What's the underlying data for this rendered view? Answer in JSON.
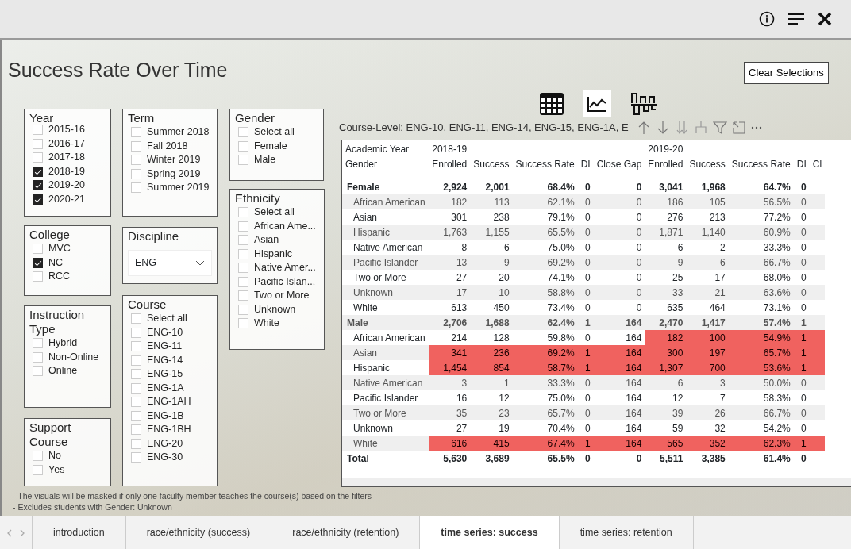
{
  "report_title": "Success Rate Over Time",
  "clear_button": "Clear Selections",
  "slicers": [
    {
      "title": "Year",
      "kind": "list",
      "items": [
        {
          "label": "2015-16",
          "checked": false
        },
        {
          "label": "2016-17",
          "checked": false
        },
        {
          "label": "2017-18",
          "checked": false
        },
        {
          "label": "2018-19",
          "checked": true
        },
        {
          "label": "2019-20",
          "checked": true
        },
        {
          "label": "2020-21",
          "checked": true
        }
      ]
    },
    {
      "title": "Term",
      "kind": "list",
      "items": [
        {
          "label": "Summer 2018",
          "checked": false
        },
        {
          "label": "Fall 2018",
          "checked": false
        },
        {
          "label": "Winter 2019",
          "checked": false
        },
        {
          "label": "Spring 2019",
          "checked": false
        },
        {
          "label": "Summer 2019",
          "checked": false
        }
      ]
    },
    {
      "title": "Gender",
      "kind": "list",
      "items": [
        {
          "label": "Select all",
          "checked": false
        },
        {
          "label": "Female",
          "checked": false
        },
        {
          "label": "Male",
          "checked": false
        }
      ]
    },
    {
      "title": "College",
      "kind": "list",
      "items": [
        {
          "label": "MVC",
          "checked": false
        },
        {
          "label": "NC",
          "checked": true
        },
        {
          "label": "RCC",
          "checked": false
        }
      ]
    },
    {
      "title": "Discipline",
      "kind": "dropdown",
      "value": "ENG"
    },
    {
      "title": "Ethnicity",
      "kind": "list",
      "items": [
        {
          "label": "Select all",
          "checked": false
        },
        {
          "label": "African Ame...",
          "checked": false
        },
        {
          "label": "Asian",
          "checked": false
        },
        {
          "label": "Hispanic",
          "checked": false
        },
        {
          "label": "Native Amer...",
          "checked": false
        },
        {
          "label": "Pacific Islan...",
          "checked": false
        },
        {
          "label": "Two or More",
          "checked": false
        },
        {
          "label": "Unknown",
          "checked": false
        },
        {
          "label": "White",
          "checked": false
        }
      ]
    },
    {
      "title": "Instruction Type",
      "kind": "list",
      "items": [
        {
          "label": "Hybrid",
          "checked": false
        },
        {
          "label": "Non-Online",
          "checked": false
        },
        {
          "label": "Online",
          "checked": false
        }
      ]
    },
    {
      "title": "Course",
      "kind": "list",
      "items": [
        {
          "label": "Select all",
          "checked": false
        },
        {
          "label": "ENG-10",
          "checked": false
        },
        {
          "label": "ENG-11",
          "checked": false
        },
        {
          "label": "ENG-14",
          "checked": false
        },
        {
          "label": "ENG-15",
          "checked": false
        },
        {
          "label": "ENG-1A",
          "checked": false
        },
        {
          "label": "ENG-1AH",
          "checked": false
        },
        {
          "label": "ENG-1B",
          "checked": false
        },
        {
          "label": "ENG-1BH",
          "checked": false
        },
        {
          "label": "ENG-20",
          "checked": false
        },
        {
          "label": "ENG-30",
          "checked": false
        }
      ]
    },
    {
      "title": "Support Course",
      "kind": "list",
      "items": [
        {
          "label": "No",
          "checked": false
        },
        {
          "label": "Yes",
          "checked": false
        }
      ]
    }
  ],
  "visual_title": "Course-Level: ENG-10, ENG-11, ENG-14, ENG-15, ENG-1A, E",
  "table": {
    "corner": [
      "Academic Year",
      "Gender"
    ],
    "years": [
      {
        "label": "2018-19",
        "columns": [
          "Enrolled",
          "Success",
          "Success Rate",
          "DI",
          "Close Gap"
        ]
      },
      {
        "label": "2019-20",
        "columns": [
          "Enrolled",
          "Success",
          "Success Rate",
          "DI",
          "Cl"
        ]
      }
    ],
    "rows": [
      {
        "label": "Female",
        "kind": "group",
        "cells": [
          "2,924",
          "2,001",
          "68.4%",
          "0",
          "0",
          "3,041",
          "1,968",
          "64.7%",
          "0"
        ],
        "flagged": [
          false,
          false
        ]
      },
      {
        "label": "African American",
        "kind": "detail",
        "cells": [
          "182",
          "113",
          "62.1%",
          "0",
          "0",
          "186",
          "105",
          "56.5%",
          "0"
        ],
        "flagged": [
          false,
          false
        ]
      },
      {
        "label": "Asian",
        "kind": "detail",
        "cells": [
          "301",
          "238",
          "79.1%",
          "0",
          "0",
          "276",
          "213",
          "77.2%",
          "0"
        ],
        "flagged": [
          false,
          false
        ]
      },
      {
        "label": "Hispanic",
        "kind": "detail",
        "cells": [
          "1,763",
          "1,155",
          "65.5%",
          "0",
          "0",
          "1,871",
          "1,140",
          "60.9%",
          "0"
        ],
        "flagged": [
          false,
          false
        ]
      },
      {
        "label": "Native American",
        "kind": "detail",
        "cells": [
          "8",
          "6",
          "75.0%",
          "0",
          "0",
          "6",
          "2",
          "33.3%",
          "0"
        ],
        "flagged": [
          false,
          false
        ]
      },
      {
        "label": "Pacific Islander",
        "kind": "detail",
        "cells": [
          "13",
          "9",
          "69.2%",
          "0",
          "0",
          "9",
          "6",
          "66.7%",
          "0"
        ],
        "flagged": [
          false,
          false
        ]
      },
      {
        "label": "Two or More",
        "kind": "detail",
        "cells": [
          "27",
          "20",
          "74.1%",
          "0",
          "0",
          "25",
          "17",
          "68.0%",
          "0"
        ],
        "flagged": [
          false,
          false
        ]
      },
      {
        "label": "Unknown",
        "kind": "detail",
        "cells": [
          "17",
          "10",
          "58.8%",
          "0",
          "0",
          "33",
          "21",
          "63.6%",
          "0"
        ],
        "flagged": [
          false,
          false
        ]
      },
      {
        "label": "White",
        "kind": "detail",
        "cells": [
          "613",
          "450",
          "73.4%",
          "0",
          "0",
          "635",
          "464",
          "73.1%",
          "0"
        ],
        "flagged": [
          false,
          false
        ]
      },
      {
        "label": "Male",
        "kind": "group",
        "cells": [
          "2,706",
          "1,688",
          "62.4%",
          "1",
          "164",
          "2,470",
          "1,417",
          "57.4%",
          "1"
        ],
        "flagged": [
          false,
          false
        ]
      },
      {
        "label": "African American",
        "kind": "detail",
        "cells": [
          "214",
          "128",
          "59.8%",
          "0",
          "164",
          "182",
          "100",
          "54.9%",
          "1"
        ],
        "flagged": [
          false,
          true
        ]
      },
      {
        "label": "Asian",
        "kind": "detail",
        "cells": [
          "341",
          "236",
          "69.2%",
          "1",
          "164",
          "300",
          "197",
          "65.7%",
          "1"
        ],
        "flagged": [
          true,
          true
        ]
      },
      {
        "label": "Hispanic",
        "kind": "detail",
        "cells": [
          "1,454",
          "854",
          "58.7%",
          "1",
          "164",
          "1,307",
          "700",
          "53.6%",
          "1"
        ],
        "flagged": [
          true,
          true
        ]
      },
      {
        "label": "Native American",
        "kind": "detail",
        "cells": [
          "3",
          "1",
          "33.3%",
          "0",
          "164",
          "6",
          "3",
          "50.0%",
          "0"
        ],
        "flagged": [
          false,
          false
        ]
      },
      {
        "label": "Pacific Islander",
        "kind": "detail",
        "cells": [
          "16",
          "12",
          "75.0%",
          "0",
          "164",
          "12",
          "7",
          "58.3%",
          "0"
        ],
        "flagged": [
          false,
          false
        ]
      },
      {
        "label": "Two or More",
        "kind": "detail",
        "cells": [
          "35",
          "23",
          "65.7%",
          "0",
          "164",
          "39",
          "26",
          "66.7%",
          "0"
        ],
        "flagged": [
          false,
          false
        ]
      },
      {
        "label": "Unknown",
        "kind": "detail",
        "cells": [
          "27",
          "19",
          "70.4%",
          "0",
          "164",
          "59",
          "32",
          "54.2%",
          "0"
        ],
        "flagged": [
          false,
          false
        ]
      },
      {
        "label": "White",
        "kind": "detail",
        "cells": [
          "616",
          "415",
          "67.4%",
          "1",
          "164",
          "565",
          "352",
          "62.3%",
          "1"
        ],
        "flagged": [
          true,
          true
        ]
      },
      {
        "label": "Total",
        "kind": "total",
        "cells": [
          "5,630",
          "3,689",
          "65.5%",
          "0",
          "0",
          "5,511",
          "3,385",
          "61.4%",
          "0"
        ],
        "flagged": [
          false,
          false
        ]
      }
    ]
  },
  "notes": [
    "- The visuals will be masked if only one faculty member teaches the course(s) based on the filters",
    "- Excludes students with Gender: Unknown"
  ],
  "tabs": [
    {
      "label": "introduction",
      "selected": false
    },
    {
      "label": "race/ethnicity (success)",
      "selected": false
    },
    {
      "label": "race/ethnicity (retention)",
      "selected": false
    },
    {
      "label": "time series: success",
      "selected": true
    },
    {
      "label": "time series: retention",
      "selected": false
    }
  ]
}
